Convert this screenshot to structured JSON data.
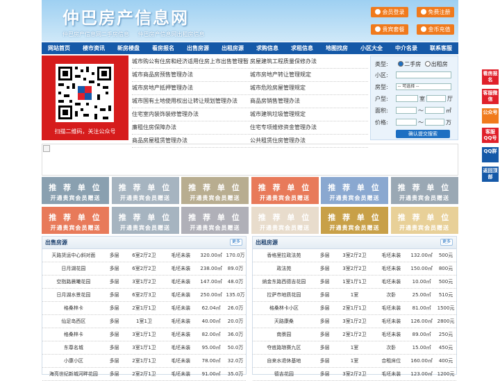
{
  "header": {
    "title": "仲巴房产信息网",
    "subtitle": [
      "仲巴房产信息网二手房信息",
      "仲巴房产信息网出租房信息"
    ],
    "buttons": [
      "会员登录",
      "免费注册",
      "贵宾套餐",
      "金币充值"
    ]
  },
  "nav": [
    "网站首页",
    "楼市资讯",
    "新房楼盘",
    "看房报名",
    "出售房源",
    "出租房源",
    "求购信息",
    "求租信息",
    "地图找房",
    "小区大全",
    "中介名录",
    "联系客服"
  ],
  "qr_caption": "扫描二维码，关注公众号",
  "links": [
    [
      "城市购公有住房和经济适用住房上市出售管理暂",
      "房屋建筑工程质量保修办法"
    ],
    [
      "城市商品房预售管理办法",
      "城市房地产转让管理规定"
    ],
    [
      "城市房地产抵押管理办法",
      "城市危险房屋管理规定"
    ],
    [
      "城市国有土地使用权出让转让规划管理办法",
      "商品房销售管理办法"
    ],
    [
      "住宅室内装饰装修管理办法",
      "城市建筑垃圾管理规定"
    ],
    [
      "廉租住房保障办法",
      "住宅专项维修资金管理办法"
    ],
    [
      "商品房屋租赁管理办法",
      "公共租赁住房管理办法"
    ]
  ],
  "search": {
    "type_label": "类型:",
    "opt1": "二手房",
    "opt2": "出租房",
    "community_label": "小区:",
    "house_type_label": "房型:",
    "house_type_value": "-- 可选择 --",
    "layout_label": "户型:",
    "room_unit": "室",
    "hall_unit": "厅",
    "area_label": "面积:",
    "area_unit": "㎡",
    "price_label": "价格:",
    "price_unit": "万",
    "range_sep": "〜",
    "submit": "确认提交搜索"
  },
  "ads": {
    "line1": "推 荐 单 位",
    "line2": "开通贵宾会员赠送",
    "colors": [
      "#8aa0b0",
      "#a6b4c0",
      "#b8ad90",
      "#e87a5a",
      "#8aa8d0",
      "#9aa8b4",
      "#e87a5a",
      "#a6b4c0",
      "#b0b0b8",
      "#e8dccc",
      "#c8a048",
      "#e8d098"
    ]
  },
  "sale": {
    "title": "出售房源",
    "more": "更多",
    "rows": [
      [
        "天路货运中心斜对面",
        "多层",
        "6室2厅2卫",
        "毛坯未装",
        "320.00㎡",
        "170.0万"
      ],
      [
        "日月湖花园",
        "多层",
        "6室2厅2卫",
        "毛坯未装",
        "238.00㎡",
        "89.0万"
      ],
      [
        "空指路晨曦花园",
        "多层",
        "3室1厅2卫",
        "毛坯未装",
        "147.00㎡",
        "48.0万"
      ],
      [
        "日月湖水景花园",
        "多层",
        "6室2厅3卫",
        "毛坯未装",
        "250.00㎡",
        "135.0万"
      ],
      [
        "格桑林卡",
        "多层",
        "2室1厅1卫",
        "毛坯未装",
        "62.04㎡",
        "26.0万"
      ],
      [
        "仙足岛西区",
        "多层",
        "1室1卫",
        "毛坯未装",
        "40.00㎡",
        "20.0万"
      ],
      [
        "格桑林卡",
        "多层",
        "3室1厅1卫",
        "毛坯未装",
        "82.00㎡",
        "36.0万"
      ],
      [
        "东尊名城",
        "多层",
        "3室1厅1卫",
        "毛坯未装",
        "95.00㎡",
        "50.0万"
      ],
      [
        "小康小区",
        "多层",
        "2室1厅1卫",
        "毛坯未装",
        "78.00㎡",
        "32.0万"
      ],
      [
        "海亮世纪新城河畔花园",
        "多层",
        "2室2厅1卫",
        "毛坯未装",
        "91.00㎡",
        "35.0万"
      ]
    ]
  },
  "rent": {
    "title": "出租房源",
    "more": "更多",
    "rows": [
      [
        "香格里拉政法苑",
        "多层",
        "3室2厅2卫",
        "毛坯未装",
        "132.00㎡",
        "500元"
      ],
      [
        "政法苑",
        "多层",
        "3室2厅2卫",
        "毛坯未装",
        "150.00㎡",
        "800元"
      ],
      [
        "纳金东路西德吉花园",
        "多层",
        "1室1厅1卫",
        "毛坯未装",
        "10.00㎡",
        "500元"
      ],
      [
        "拉萨市地质花园",
        "多层",
        "1室",
        "次卧",
        "25.00㎡",
        "510元"
      ],
      [
        "格桑林卡小区",
        "多层",
        "2室1厅1卫",
        "毛坯未装",
        "81.00㎡",
        "1500元"
      ],
      [
        "天路康桑",
        "多层",
        "3室1厅2卫",
        "毛坯未装",
        "126.00㎡",
        "2800元"
      ],
      [
        "南景园",
        "多层",
        "2室1厅2卫",
        "毛坯未装",
        "89.00㎡",
        "250元"
      ],
      [
        "夺底路琅赛九区",
        "多层",
        "1室",
        "次卧",
        "15.00㎡",
        "450元"
      ],
      [
        "自来水退休基地",
        "多层",
        "1室",
        "合租床位",
        "160.00㎡",
        "400元"
      ],
      [
        "德吉花园",
        "多层",
        "3室2厅2卫",
        "毛坯未装",
        "123.00㎡",
        "1200元"
      ]
    ]
  },
  "float": [
    "看房报名",
    "客服微信",
    "公众号",
    "客服QQ号",
    "QQ群",
    "返回顶部"
  ],
  "float_colors": [
    "#e0202a",
    "#e0202a",
    "#f07a1c",
    "#e0202a",
    "#1559a8",
    "#1559a8"
  ]
}
